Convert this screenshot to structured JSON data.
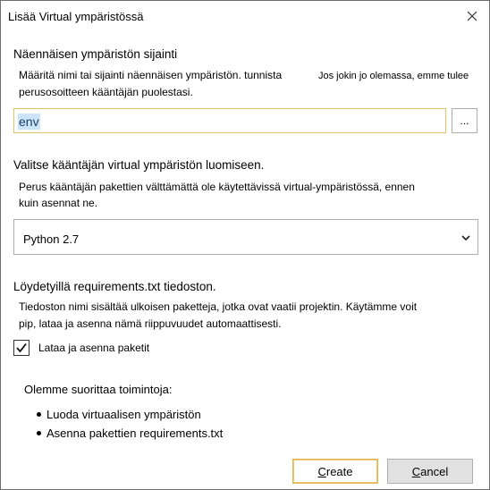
{
  "window": {
    "title": "Lisää Virtual ympäristössä",
    "close_icon": "close-icon"
  },
  "location": {
    "heading": "Näennäisen ympäristön sijainti",
    "help_left": "Määritä nimi tai sijainti näennäisen ympäristön. tunnista",
    "help_right": "Jos jokin jo olemassa, emme tulee",
    "help_line2": "perusosoitteen kääntäjän puolestasi.",
    "path_value": "env",
    "browse_label": "..."
  },
  "interpreter": {
    "heading": "Valitse kääntäjän virtual ympäristön luomiseen.",
    "help_line1": "Perus kääntäjän pakettien välttämättä ole käytettävissä virtual-ympäristössä, ennen",
    "help_line2": "kuin asennat ne.",
    "selected": "Python 2.7"
  },
  "requirements": {
    "heading": "Löydetyillä requirements.txt tiedoston.",
    "help_line1": "Tiedoston nimi sisältää ulkoisen paketteja, jotka ovat vaatii projektin. Käytämme voit",
    "help_line2": "pip, lataa ja asenna nämä riippuvuudet automaattisesti.",
    "checkbox_label": "Lataa ja asenna paketit",
    "checked": true
  },
  "actions": {
    "heading": "Olemme suorittaa toimintoja:",
    "items": [
      "Luoda virtuaalisen ympäristön",
      "Asenna pakettien requirements.txt"
    ]
  },
  "buttons": {
    "create_first": "C",
    "create_rest": "reate",
    "cancel_first": "C",
    "cancel_rest": "ancel"
  },
  "colors": {
    "focus_border": "#e3c26a",
    "selection": "#cce4f7"
  }
}
